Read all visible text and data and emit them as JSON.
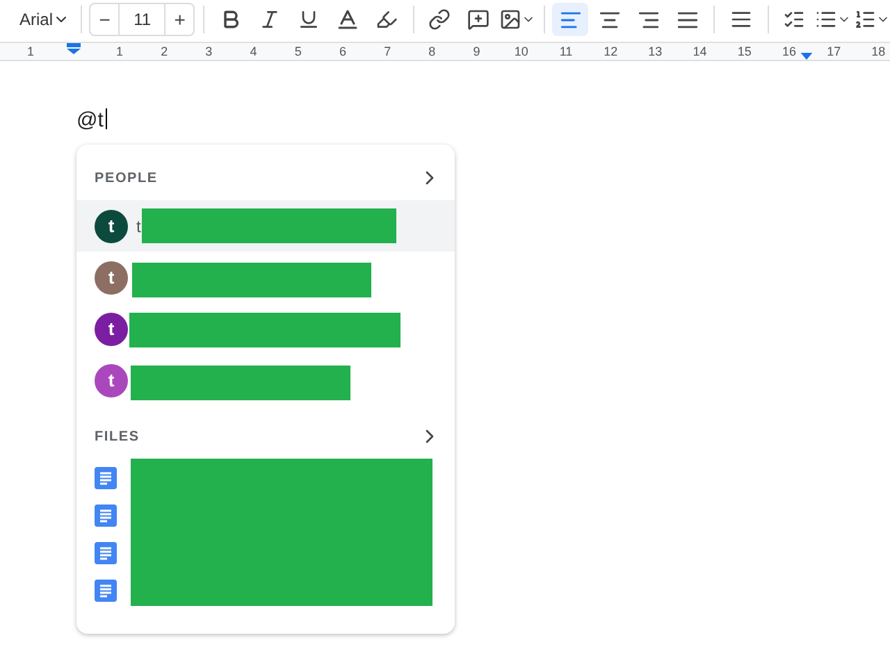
{
  "toolbar": {
    "font": "Arial",
    "font_size": "11",
    "minus": "−",
    "plus": "+",
    "alignments": [
      {
        "kind": "left",
        "selected": true
      },
      {
        "kind": "center",
        "selected": false
      },
      {
        "kind": "right",
        "selected": false
      },
      {
        "kind": "justify",
        "selected": false
      }
    ]
  },
  "ruler": {
    "numbers": [
      "1",
      "1",
      "2",
      "3",
      "4",
      "5",
      "6",
      "7",
      "8",
      "9",
      "10",
      "11",
      "12",
      "13",
      "14",
      "15",
      "16",
      "17",
      "18"
    ]
  },
  "document": {
    "text": "@t"
  },
  "mention_menu": {
    "people": {
      "title": "PEOPLE",
      "items": [
        {
          "letter": "t",
          "color": "#0d4a3e",
          "name": "t",
          "redacted": true,
          "selected": true
        },
        {
          "letter": "t",
          "color": "#8d6e63",
          "redacted": true,
          "selected": false
        },
        {
          "letter": "t",
          "color": "#7b1fa2",
          "redacted": true,
          "selected": false
        },
        {
          "letter": "t",
          "color": "#ab47bc",
          "redacted": true,
          "selected": false
        }
      ]
    },
    "files": {
      "title": "FILES",
      "items": [
        {
          "kind": "doc"
        },
        {
          "kind": "doc"
        },
        {
          "kind": "doc"
        },
        {
          "kind": "doc"
        }
      ],
      "redacted": true
    }
  }
}
